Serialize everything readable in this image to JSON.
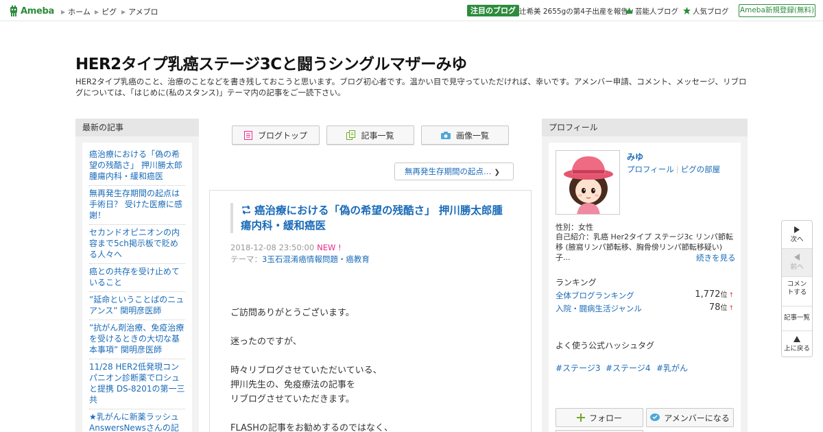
{
  "topbar": {
    "logo_text": "Ameba",
    "nav": [
      "ホーム",
      "ピグ",
      "アメブロ"
    ],
    "pickup_badge": "注目のブログ",
    "pickup_text": "辻希美 2655gの第4子出産を報告",
    "celebrity_blog": "芸能人ブログ",
    "popular_blog": "人気ブログ",
    "register": "Ameba新規登録(無料)"
  },
  "header": {
    "title": "HER2タイプ乳癌ステージ3Cと闘うシングルマザーみゆ",
    "description": "HER2タイプ乳癌のこと、治療のことなどを書き残しておこうと思います。ブログ初心者です。温かい目で見守っていただければ、幸いです。アメンバー申請、コメント、メッセージ、リブログについては、「はじめに(私のスタンス)」テーマ内の記事をご一読下さい。"
  },
  "left": {
    "heading": "最新の記事",
    "items": [
      "癌治療における「偽の希望の残酷さ」 押川勝太郎腫瘍内科・緩和癌医",
      "無再発生存期間の起点は手術日？ 受けた医療に感謝！",
      "セカンドオピニオンの内容まで5ch掲示板で貶める人々へ",
      "癌との共存を受け止めていること",
      "”延命ということばのニュアンス” 関明彦医師",
      "”抗がん剤治療、免疫治療を受けるときの大切な基本事項” 関明彦医師",
      "11/28 HER2低発現コンパニオン診断薬でロシュと提携 DS-8201の第一三共",
      "★乳がんに新薬ラッシュ AnswersNewsさんの記事より"
    ]
  },
  "center": {
    "tabs": [
      "ブログトップ",
      "記事一覧",
      "画像一覧"
    ],
    "next_entry": "無再発生存期間の起点…",
    "article": {
      "title": "癌治療における「偽の希望の残酷さ」 押川勝太郎腫瘍内科・緩和癌医",
      "date": "2018-12-08 23:50:00",
      "new_label": "NEW !",
      "theme_label": "テーマ：",
      "theme": "3玉石混淆癌情報問題・癌教育",
      "body": [
        "ご訪問ありがとうございます。",
        "迷ったのですが、",
        "時々リブログさせていただいている、",
        "押川先生の、免疫療法の記事を",
        "リブログさせていただきます。",
        "FLASHの記事をお勧めするのではなく、"
      ]
    }
  },
  "right": {
    "heading": "プロフィール",
    "name": "みゆ",
    "profile_link": "プロフィール",
    "pigg_link": "ピグの部屋",
    "gender": "性別：女性",
    "intro": "自己紹介：乳癌 Her2タイプ ステージ3c リンパ節転移 (腋窩リンパ節転移、胸骨傍リンパ節転移疑い) 子...",
    "more": "続きを見る",
    "ranking_heading": "ランキング",
    "rankings": [
      {
        "label": "全体ブログランキング",
        "value": "1,772",
        "unit": "位",
        "arrow": "↑"
      },
      {
        "label": "入院・闘病生活ジャンル",
        "value": "78",
        "unit": "位",
        "arrow": "↑"
      }
    ],
    "hashtag_heading": "よく使う公式ハッシュタグ",
    "hashtags": [
      "#ステージ3",
      "#ステージ4",
      "#乳がん"
    ],
    "follow": "フォロー",
    "amember": "アメンバーになる"
  },
  "floatnav": {
    "next": "次へ",
    "prev": "前へ",
    "comment": "コメントする",
    "list": "記事一覧",
    "top": "上に戻る"
  },
  "colors": {
    "ameba_green": "#2d8c3c",
    "link_blue": "#1a6bb8",
    "new_pink": "#e8298a"
  }
}
